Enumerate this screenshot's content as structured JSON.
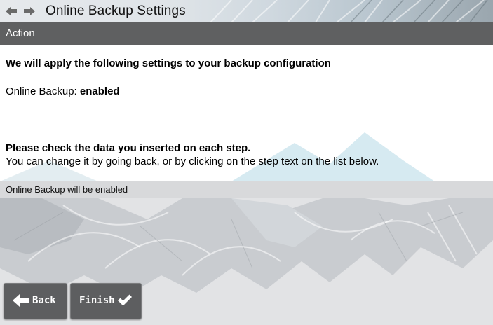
{
  "header": {
    "title": "Online Backup Settings",
    "back_icon": "arrow-left-icon",
    "forward_icon": "arrow-right-icon"
  },
  "action_bar": {
    "label": "Action"
  },
  "content": {
    "heading": "We will apply the following settings to your backup configuration",
    "setting_label": "Online Backup: ",
    "setting_value": "enabled",
    "check_heading": "Please check the data you inserted on each step.",
    "check_text": "You can change it by going back, or by clicking on the step text on the list below."
  },
  "summary": {
    "items": [
      "Online Backup will be enabled"
    ]
  },
  "buttons": {
    "back_label": "Back",
    "back_icon": "arrow-left-icon",
    "finish_label": "Finish",
    "finish_icon": "checkmark-icon"
  },
  "colors": {
    "action_bar": "#5f6061",
    "button": "#5d5e60",
    "content_bg": "#ffffff",
    "mountain_accent": "#d6eaf1"
  }
}
